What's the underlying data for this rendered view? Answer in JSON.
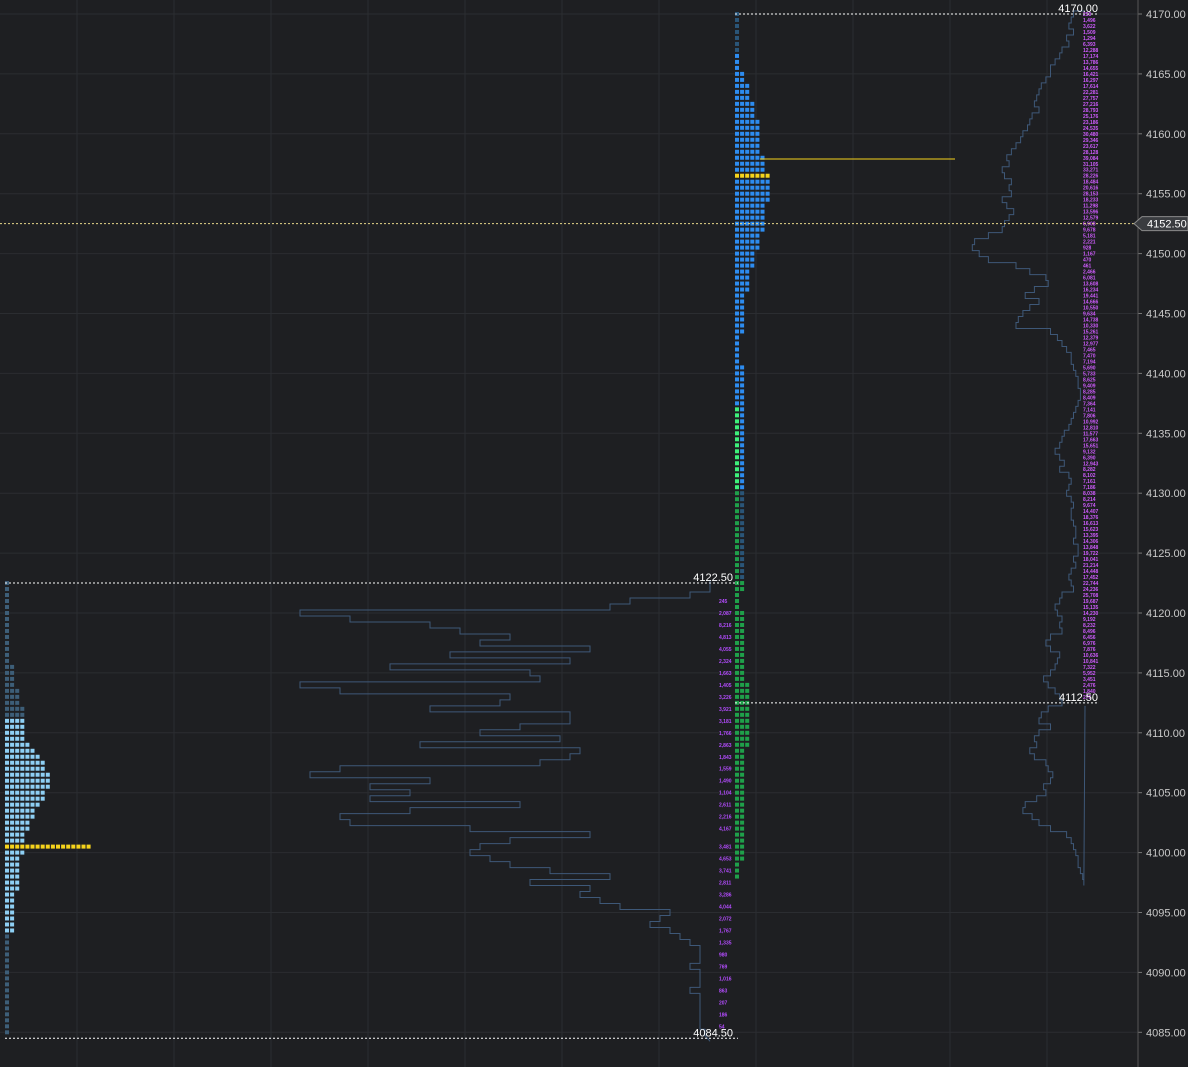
{
  "chart_data": {
    "type": "market-profile",
    "price_axis": {
      "ticks": [
        "4170.00",
        "4165.00",
        "4160.00",
        "4155.00",
        "4150.00",
        "4145.00",
        "4140.00",
        "4135.00",
        "4130.00",
        "4125.00",
        "4120.00",
        "4115.00",
        "4110.00",
        "4105.00",
        "4100.00",
        "4095.00",
        "4090.00",
        "4085.00"
      ],
      "range": [
        4083.4,
        4170.9
      ],
      "current_price": "4152.50",
      "grid": true
    },
    "colors": {
      "background": "#1e1f22",
      "grid": "#2b2d31",
      "tpo_left": "#8ecff4",
      "tpo_left_dim": "#3d5e78",
      "tpo_right": "#2d8cf0",
      "tpo_right_dim": "#2a5578",
      "tpo_green": "#1fa04a",
      "tpo_bright_green": "#3df07a",
      "poc": "#f5d31c",
      "volume_outline": "#3e5878",
      "volume_text": "#b44cff",
      "range_line": "#ffffff",
      "price_line": "#e8d88a"
    },
    "sessions": [
      {
        "name": "left",
        "high_label": "4122.50",
        "low_label": "4084.50",
        "high": 4122.5,
        "low": 4084.5,
        "poc": 4100.5,
        "tpo_counts": [
          1,
          1,
          1,
          1,
          1,
          1,
          1,
          1,
          1,
          1,
          1,
          1,
          1,
          1,
          2,
          2,
          2,
          2,
          3,
          3,
          3,
          4,
          4,
          4,
          4,
          4,
          4,
          5,
          6,
          7,
          8,
          8,
          9,
          9,
          9,
          8,
          8,
          7,
          6,
          6,
          5,
          5,
          4,
          4,
          4,
          4,
          3,
          3,
          3,
          3,
          3,
          3,
          2,
          2,
          2,
          2,
          2,
          2,
          2,
          1,
          1,
          1,
          1,
          1,
          1,
          1,
          1,
          1,
          1,
          1,
          1,
          1,
          1,
          1,
          1,
          1
        ],
        "volume_profile": [
          0,
          0,
          0.2,
          0.8,
          1.0,
          4.1,
          3.6,
          2.8,
          2.5,
          2.0,
          2.3,
          1.2,
          2.6,
          1.4,
          3.2,
          1.8,
          1.7,
          4.1,
          3.7,
          2.0,
          2.1,
          2.8,
          1.4,
          1.4,
          1.9,
          2.3,
          1.5,
          2.9,
          1.3,
          1.4,
          1.7,
          3.7,
          4.0,
          2.8,
          3.4,
          3.0,
          3.4,
          1.9,
          3.0,
          3.7,
          3.6,
          2.4,
          1.2,
          2.0,
          2.3,
          2.4,
          2.2,
          2.0,
          1.6,
          1.0,
          1.8,
          1.2,
          1.3,
          1.1,
          0.9,
          0.4,
          0.5,
          0.6,
          0.4,
          0.3,
          0.2,
          0.1,
          0.1,
          0.1,
          0.2,
          0.1,
          0.1,
          0.1,
          0.2,
          0.1,
          0.1,
          0.1,
          0.1,
          0.1,
          0.1,
          0.05
        ],
        "volume_labels": [
          {
            "price": 4121.0,
            "text": "245"
          },
          {
            "price": 4120.0,
            "text": "2,087"
          },
          {
            "price": 4119.0,
            "text": "8,216"
          },
          {
            "price": 4118.0,
            "text": "4,813"
          },
          {
            "price": 4117.0,
            "text": "4,055"
          },
          {
            "price": 4116.0,
            "text": "2,324"
          },
          {
            "price": 4115.0,
            "text": "1,663"
          },
          {
            "price": 4114.0,
            "text": "1,405"
          },
          {
            "price": 4113.0,
            "text": "3,226"
          },
          {
            "price": 4112.0,
            "text": "3,921"
          },
          {
            "price": 4111.0,
            "text": "3,181"
          },
          {
            "price": 4110.0,
            "text": "1,766"
          },
          {
            "price": 4109.0,
            "text": "2,863"
          },
          {
            "price": 4108.0,
            "text": "1,843"
          },
          {
            "price": 4107.0,
            "text": "1,559"
          },
          {
            "price": 4106.0,
            "text": "1,490"
          },
          {
            "price": 4105.0,
            "text": "1,104"
          },
          {
            "price": 4104.0,
            "text": "2,611"
          },
          {
            "price": 4103.0,
            "text": "2,216"
          },
          {
            "price": 4102.0,
            "text": "4,167"
          },
          {
            "price": 4100.5,
            "text": "3,481"
          },
          {
            "price": 4099.5,
            "text": "4,653"
          },
          {
            "price": 4098.5,
            "text": "3,741"
          },
          {
            "price": 4097.5,
            "text": "2,811"
          },
          {
            "price": 4096.5,
            "text": "3,286"
          },
          {
            "price": 4095.5,
            "text": "4,044"
          },
          {
            "price": 4094.5,
            "text": "2,072"
          },
          {
            "price": 4093.5,
            "text": "1,767"
          },
          {
            "price": 4092.5,
            "text": "1,335"
          },
          {
            "price": 4091.5,
            "text": "980"
          },
          {
            "price": 4090.5,
            "text": "769"
          },
          {
            "price": 4089.5,
            "text": "1,016"
          },
          {
            "price": 4088.5,
            "text": "863"
          },
          {
            "price": 4087.5,
            "text": "207"
          },
          {
            "price": 4086.5,
            "text": "186"
          },
          {
            "price": 4085.5,
            "text": "54"
          }
        ]
      },
      {
        "name": "right",
        "high_label": "4170.00",
        "low_label": "4112.50",
        "high": 4170.0,
        "low": 4112.5,
        "poc": 4156.5,
        "volume_poc_price": 4157.9,
        "tpo_counts": [
          1,
          1,
          1,
          1,
          1,
          1,
          1,
          1,
          1,
          1,
          2,
          2,
          3,
          3,
          3,
          4,
          4,
          4,
          5,
          5,
          5,
          5,
          5,
          5,
          6,
          6,
          6,
          7,
          7,
          7,
          7,
          7,
          6,
          6,
          6,
          6,
          6,
          5,
          5,
          5,
          4,
          4,
          4,
          3,
          3,
          3,
          3,
          2,
          2,
          2,
          2,
          2,
          2,
          2,
          1,
          1,
          1,
          1,
          1,
          2,
          2,
          2,
          2,
          2,
          2,
          2,
          2,
          2,
          2,
          2,
          2,
          2,
          2,
          2,
          2,
          2,
          2,
          2,
          2,
          2,
          2,
          2,
          2,
          2,
          2,
          2,
          2,
          2,
          2,
          2,
          2,
          2,
          2,
          2,
          2,
          2,
          2,
          1,
          1,
          1,
          2,
          2,
          2,
          2,
          2,
          2,
          2,
          2,
          2,
          2,
          2,
          2,
          3,
          3,
          3,
          3,
          3,
          3,
          3,
          3,
          3,
          3,
          3,
          2,
          2,
          2,
          2,
          2,
          2,
          2,
          2,
          2,
          2,
          2,
          2,
          2,
          2,
          2,
          2,
          2,
          2,
          2,
          1,
          1,
          1
        ],
        "volume_profile": [
          0.5,
          0.6,
          0.7,
          0.5,
          0.8,
          0.7,
          1.0,
          1.1,
          1.3,
          1.5,
          1.5,
          1.7,
          1.9,
          2.0,
          2.1,
          2.2,
          2.0,
          2.3,
          2.4,
          2.5,
          2.7,
          2.8,
          3.0,
          3.2,
          3.4,
          3.3,
          3.6,
          3.5,
          3.2,
          3.3,
          3.2,
          3.6,
          3.4,
          3.1,
          3.3,
          3.5,
          3.6,
          4.2,
          4.8,
          4.9,
          4.6,
          4.2,
          3.0,
          2.4,
          1.7,
          1.6,
          2.2,
          2.6,
          2.0,
          2.4,
          2.7,
          2.9,
          3.0,
          1.5,
          1.2,
          1.0,
          0.8,
          0.6,
          0.6,
          0.5,
          0.4,
          0.3,
          0.3,
          0.2,
          0.2,
          0.3,
          0.4,
          0.5,
          0.6,
          0.7,
          0.9,
          1.0,
          1.1,
          1.3,
          1.1,
          0.9,
          1.1,
          0.7,
          0.6,
          0.7,
          0.8,
          0.6,
          0.5,
          0.6,
          0.6,
          0.5,
          0.4,
          0.4,
          0.5,
          0.3,
          0.3,
          0.5,
          0.4,
          0.6,
          0.7,
          0.6,
          0.5,
          1.0,
          1.1,
          1.3,
          1.2,
          1.0,
          1.1,
          1.0,
          1.5,
          1.7,
          1.5,
          1.1,
          1.2,
          1.3,
          1.5,
          1.8,
          1.6,
          1.3,
          1.1,
          1.0,
          1.6,
          1.9,
          2.0,
          1.5,
          2.0,
          2.2,
          2.1,
          2.4,
          2.2,
          1.7,
          1.6,
          1.4,
          1.5,
          1.8,
          1.7,
          2.1,
          2.6,
          2.7,
          2.3,
          2.0,
          1.5,
          0.8,
          0.6,
          0.5,
          0.4,
          0.3,
          0.3,
          0.2,
          0.1,
          0.05
        ],
        "volume_labels": [
          "250",
          "1,496",
          "3,622",
          "1,509",
          "1,294",
          "6,393",
          "12,288",
          "17,174",
          "13,786",
          "14,655",
          "16,421",
          "16,297",
          "17,614",
          "22,281",
          "27,757",
          "27,216",
          "28,793",
          "25,176",
          "23,186",
          "24,535",
          "30,480",
          "29,346",
          "23,617",
          "28,128",
          "39,084",
          "31,105",
          "33,271",
          "28,226",
          "18,484",
          "20,616",
          "28,153",
          "18,233",
          "11,298",
          "13,596",
          "12,579",
          "6,908",
          "9,678",
          "5,181",
          "2,221",
          "928",
          "1,167",
          "470",
          "461",
          "2,466",
          "6,081",
          "13,608",
          "16,234",
          "19,441",
          "14,666",
          "10,550",
          "9,634",
          "14,738",
          "10,330",
          "15,261",
          "12,379",
          "12,977",
          "7,465",
          "7,470",
          "7,194",
          "5,690",
          "5,733",
          "8,625",
          "9,409",
          "8,285",
          "8,409",
          "7,364",
          "7,141",
          "7,806",
          "10,992",
          "12,810",
          "11,577",
          "17,663",
          "15,651",
          "9,132",
          "6,390",
          "12,943",
          "8,282",
          "8,102",
          "7,161",
          "7,186",
          "8,038",
          "8,214",
          "9,674",
          "14,407",
          "18,376",
          "16,613",
          "15,623",
          "13,395",
          "14,306",
          "13,848",
          "19,722",
          "18,041",
          "21,214",
          "14,448",
          "17,452",
          "22,744",
          "24,236",
          "25,708",
          "19,687",
          "15,135",
          "14,230",
          "9,192",
          "8,232",
          "8,496",
          "6,456",
          "6,976",
          "7,876",
          "10,636",
          "10,841",
          "7,322",
          "5,952",
          "3,451",
          "2,476",
          "1,840",
          "276"
        ]
      }
    ]
  }
}
